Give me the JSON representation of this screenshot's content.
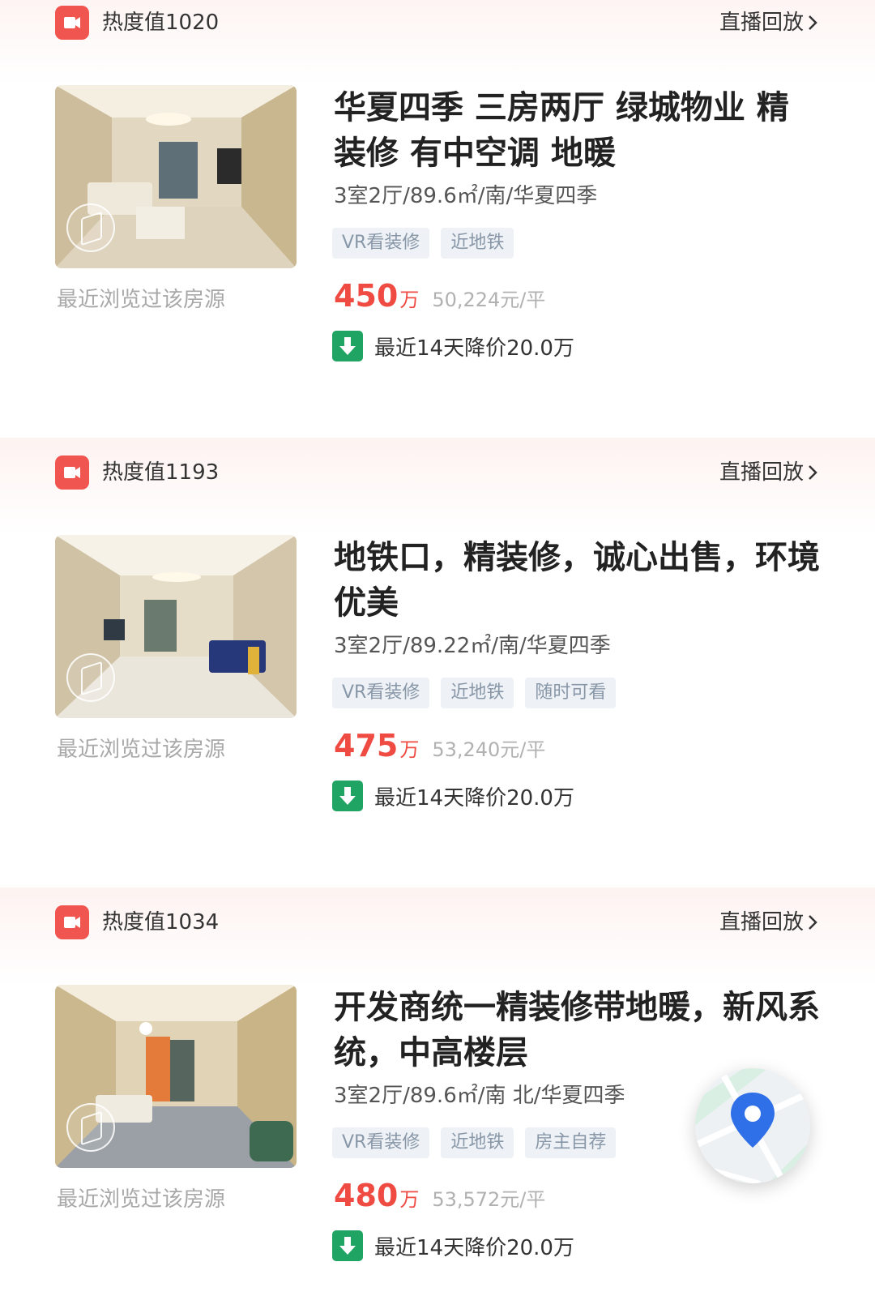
{
  "listings": [
    {
      "heat": "热度值1020",
      "replay_label": "直播回放",
      "title": "华夏四季 三房两厅 绿城物业 精装修 有中空调 地暖",
      "meta": "3室2厅/89.6㎡/南/华夏四季",
      "tags": [
        "VR看装修",
        "近地铁"
      ],
      "price": "450",
      "price_unit": "万",
      "unit_price": "50,224元/平",
      "price_drop": "最近14天降价20.0万",
      "browsed": "最近浏览过该房源"
    },
    {
      "heat": "热度值1193",
      "replay_label": "直播回放",
      "title": "地铁口，精装修，诚心出售，环境优美",
      "meta": "3室2厅/89.22㎡/南/华夏四季",
      "tags": [
        "VR看装修",
        "近地铁",
        "随时可看"
      ],
      "price": "475",
      "price_unit": "万",
      "unit_price": "53,240元/平",
      "price_drop": "最近14天降价20.0万",
      "browsed": "最近浏览过该房源"
    },
    {
      "heat": "热度值1034",
      "replay_label": "直播回放",
      "title": "开发商统一精装修带地暖，新风系统，中高楼层",
      "meta": "3室2厅/89.6㎡/南 北/华夏四季",
      "tags": [
        "VR看装修",
        "近地铁",
        "房主自荐"
      ],
      "price": "480",
      "price_unit": "万",
      "unit_price": "53,572元/平",
      "price_drop": "最近14天降价20.0万",
      "browsed": "最近浏览过该房源"
    }
  ],
  "colors": {
    "accent_red": "#ef4b43",
    "live_icon": "#f0554f",
    "drop_green": "#1fa463",
    "tag_bg": "#eef2f6",
    "tag_text": "#8897a8",
    "map_pin": "#2f6fe8"
  },
  "icons": {
    "live": "video-camera-icon",
    "replay_arrow": "chevron-right-icon",
    "price_drop": "arrow-down-icon",
    "vr": "vr-view-icon",
    "map": "map-pin-icon"
  }
}
